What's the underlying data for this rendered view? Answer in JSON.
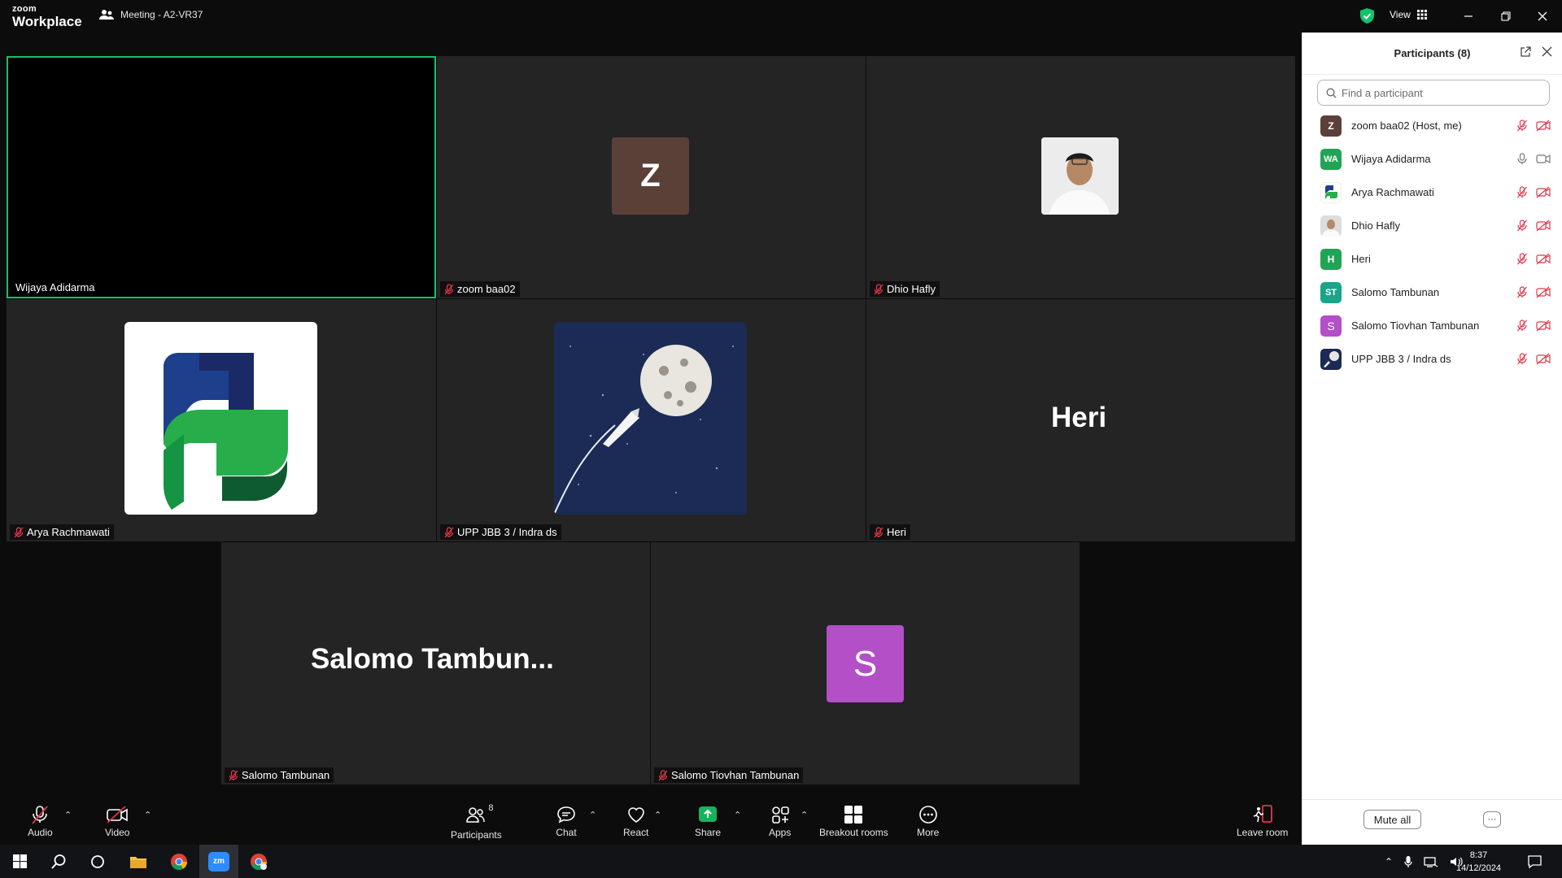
{
  "app": {
    "logo_small": "zoom",
    "logo_big": "Workplace",
    "meeting_title": "Meeting - A2-VR37",
    "view_label": "View"
  },
  "tiles": [
    {
      "name": "Wijaya Adidarma"
    },
    {
      "name": "zoom baa02",
      "avatar": "Z",
      "avatar_color": "#5b4038"
    },
    {
      "name": "Dhio Hafly"
    },
    {
      "name": "Arya Rachmawati"
    },
    {
      "name": "UPP JBB 3 / Indra ds"
    },
    {
      "name": "Heri",
      "big": "Heri"
    },
    {
      "name": "Salomo Tambunan",
      "big": "Salomo  Tambun..."
    },
    {
      "name": "Salomo Tiovhan Tambunan",
      "avatar": "S",
      "avatar_color": "#b34fc7"
    }
  ],
  "panel": {
    "title": "Participants (8)",
    "search_placeholder": "Find a participant",
    "participants": [
      {
        "name": "zoom baa02 (Host, me)",
        "avatar": "Z",
        "color": "#5b4038"
      },
      {
        "name": "Wijaya Adidarma",
        "avatar": "WA",
        "color": "#22a456"
      },
      {
        "name": "Arya Rachmawati",
        "avatar": "",
        "color": "#ffffff"
      },
      {
        "name": "Dhio Hafly",
        "avatar": "",
        "color": "#cfcfcf"
      },
      {
        "name": "Heri",
        "avatar": "H",
        "color": "#22a456"
      },
      {
        "name": "Salomo Tambunan",
        "avatar": "ST",
        "color": "#18a58a"
      },
      {
        "name": "Salomo Tiovhan Tambunan",
        "avatar": "S",
        "color": "#b34fc7"
      },
      {
        "name": "UPP JBB 3 / Indra ds",
        "avatar": "",
        "color": "#1b2d55"
      }
    ],
    "mute_all": "Mute all",
    "more": "···"
  },
  "toolbar": {
    "audio": "Audio",
    "video": "Video",
    "participants": "Participants",
    "participants_count": "8",
    "chat": "Chat",
    "react": "React",
    "share": "Share",
    "apps": "Apps",
    "breakout": "Breakout rooms",
    "more": "More",
    "leave": "Leave room"
  },
  "taskbar": {
    "time": "8:37",
    "date": "14/12/2024"
  },
  "colors": {
    "accent_green": "#14c26b",
    "mute_red": "#e0364a",
    "share_green": "#19b25c"
  }
}
